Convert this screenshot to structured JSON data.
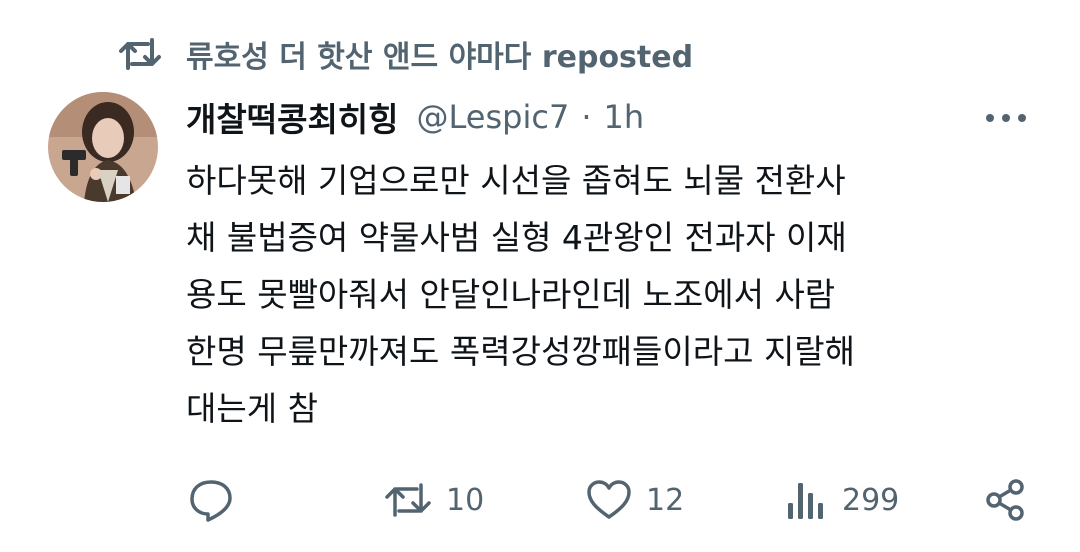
{
  "repost": {
    "icon": "repost-icon",
    "text": "류호성 더 핫산 앤드 야마다 reposted"
  },
  "author": {
    "avatar_icon": "avatar-image",
    "display_name": "개찰떡콩최히힝",
    "handle": "@Lespic7",
    "separator": "·",
    "time": "1h"
  },
  "tweet": {
    "lines": [
      "하다못해 기업으로만 시선을 좁혀도 뇌물 전환사",
      "채 불법증여 약물사범 실형 4관왕인 전과자 이재",
      "용도 못빨아줘서 안달인나라인데 노조에서 사람",
      "한명 무릎만까져도 폭력강성깡패들이라고 지랄해",
      "대는게 참"
    ]
  },
  "actions": {
    "reply": {
      "icon": "reply-icon",
      "count": ""
    },
    "repost": {
      "icon": "repost-icon",
      "count": "10"
    },
    "like": {
      "icon": "heart-icon",
      "count": "12"
    },
    "views": {
      "icon": "views-icon",
      "count": "299"
    },
    "share": {
      "icon": "share-icon"
    }
  },
  "colors": {
    "text": "#0f1419",
    "secondary": "#536471",
    "background": "#ffffff"
  }
}
